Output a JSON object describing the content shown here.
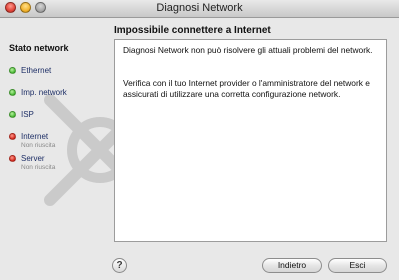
{
  "window": {
    "title": "Diagnosi Network"
  },
  "sidebar": {
    "heading": "Stato network",
    "items": [
      {
        "label": "Ethernet",
        "status": "ok",
        "sub": ""
      },
      {
        "label": "Imp. network",
        "status": "ok",
        "sub": ""
      },
      {
        "label": "ISP",
        "status": "ok",
        "sub": ""
      },
      {
        "label": "Internet",
        "status": "error",
        "sub": "Non riuscita"
      },
      {
        "label": "Server",
        "status": "error",
        "sub": "Non riuscita"
      }
    ]
  },
  "main": {
    "title": "Impossibile connettere a Internet",
    "paragraphs": [
      "Diagnosi Network non può risolvere gli attuali problemi del network.",
      "Verifica con il tuo Internet provider o l'amministratore del network e assicurati di utilizzare una corretta configurazione network."
    ]
  },
  "footer": {
    "help_label": "?",
    "back_label": "Indietro",
    "quit_label": "Esci"
  },
  "colors": {
    "ok": "#47b832",
    "error": "#d4271b",
    "link_text": "#1e2f66"
  },
  "icons": {
    "watermark": "network-diagnostics-watermark-icon"
  }
}
